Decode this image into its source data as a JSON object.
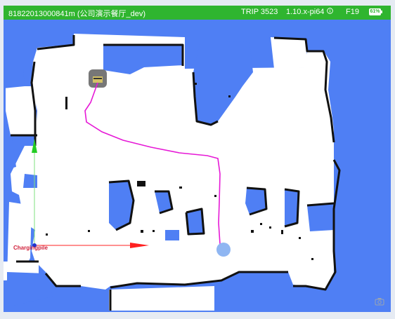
{
  "status_bar": {
    "title": "81822013000841m (公司演示餐厅_dev)",
    "trip": "TRIP 3523",
    "version": "1.10.x-pi64",
    "floor": "F19",
    "battery": "61%"
  },
  "map": {
    "charging_label": "Chargingpile"
  },
  "colors": {
    "status_bar": "#2fb52f",
    "obstacle": "#4f7ff4",
    "wall": "#111111",
    "path": "#e619d6",
    "robot": "#8fb6f2",
    "axis_x": "#ff2020",
    "axis_y": "#22cc22"
  },
  "icons": {
    "info": "info-icon",
    "battery": "battery-icon",
    "camera": "camera-icon",
    "robot": "robot-position-icon",
    "station": "charging-station-icon"
  }
}
